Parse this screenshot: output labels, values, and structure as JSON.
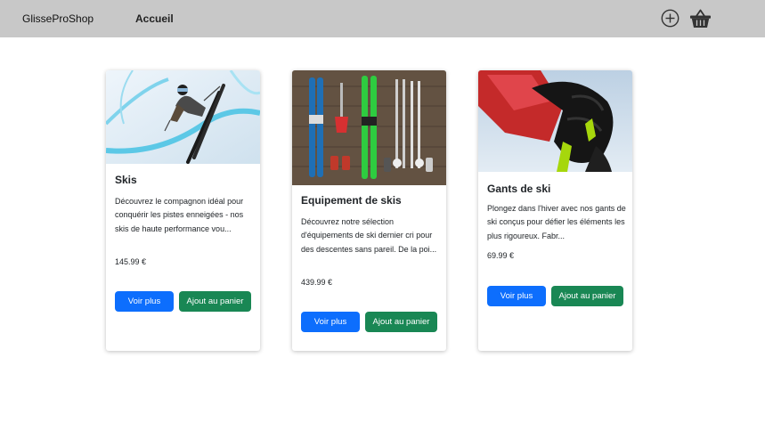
{
  "navbar": {
    "brand": "GlisseProShop",
    "home_link": "Accueil",
    "add_icon": "plus-circle-icon",
    "cart_icon": "basket-icon"
  },
  "products": [
    {
      "title": "Skis",
      "image": "freestyle-skier-halfpipe",
      "description": "Découvrez le compagnon idéal pour conquérir les pistes enneigées - nos skis de haute performance vou...",
      "price": "145.99 €",
      "more_label": "Voir plus",
      "cart_label": "Ajout au panier"
    },
    {
      "title": "Equipement de skis",
      "image": "ski-gear-flatlay-wood",
      "description": "Découvrez notre sélection d'équipements de ski dernier cri pour des descentes sans pareil. De la poi...",
      "price": "439.99 €",
      "more_label": "Voir plus",
      "cart_label": "Ajout au panier"
    },
    {
      "title": "Gants de ski",
      "image": "red-ski-glove-closeup",
      "description": "Plongez dans l'hiver avec nos gants de ski conçus pour défier les éléments les plus rigoureux. Fabr...",
      "price": "69.99 €",
      "more_label": "Voir plus",
      "cart_label": "Ajout au panier"
    }
  ],
  "colors": {
    "navbar_bg": "#c8c8c8",
    "primary": "#0d6efd",
    "success": "#198754"
  }
}
